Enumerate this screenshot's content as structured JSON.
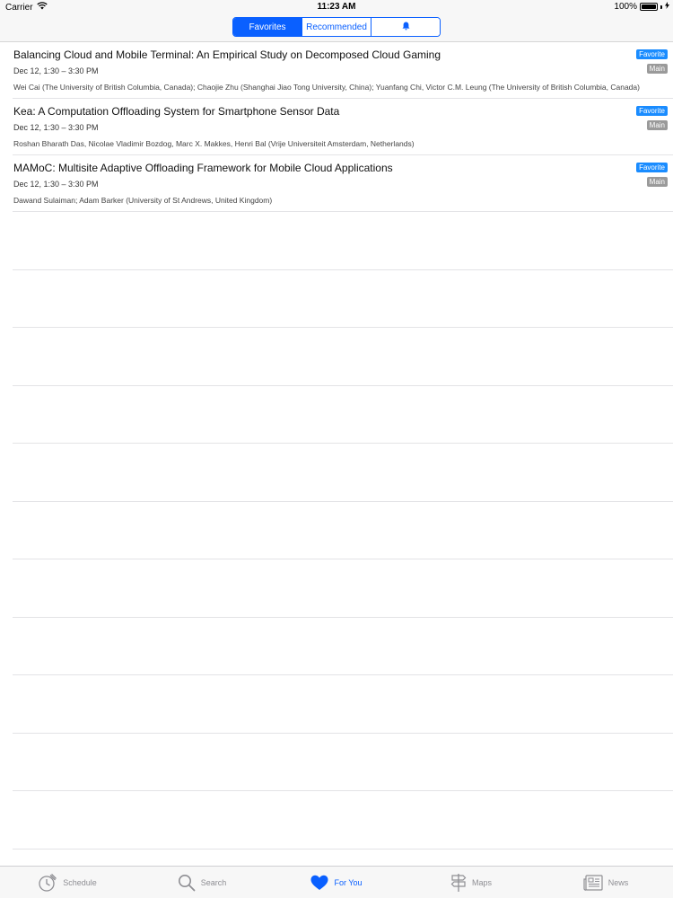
{
  "status_bar": {
    "carrier": "Carrier",
    "time": "11:23 AM",
    "battery": "100%",
    "battery_level": 1.0
  },
  "segments": [
    {
      "label": "Favorites",
      "active": true
    },
    {
      "label": "Recommended",
      "active": false
    },
    {
      "icon": "bell-icon",
      "active": false
    }
  ],
  "sessions": [
    {
      "title": "Balancing Cloud and Mobile Terminal: An Empirical Study on Decomposed Cloud Gaming",
      "time": "Dec 12, 1:30 – 3:30 PM",
      "authors": "Wei Cai (The University of British Columbia, Canada); Chaojie Zhu (Shanghai Jiao Tong University, China); Yuanfang Chi, Victor C.M. Leung (The University of British Columbia, Canada)",
      "badges": [
        "Favorite",
        "Main"
      ]
    },
    {
      "title": "Kea: A Computation Offloading System for Smartphone Sensor Data",
      "time": "Dec 12, 1:30 – 3:30 PM",
      "authors": "Roshan Bharath Das, Nicolae Vladimir Bozdog, Marc X. Makkes, Henri Bal (Vrije Universiteit Amsterdam, Netherlands)",
      "badges": [
        "Favorite",
        "Main"
      ]
    },
    {
      "title": "MAMoC: Multisite Adaptive Offloading Framework for Mobile Cloud Applications",
      "time": "Dec 12, 1:30 – 3:30 PM",
      "authors": "Dawand Sulaiman; Adam Barker (University of St Andrews, United Kingdom)",
      "badges": [
        "Favorite",
        "Main"
      ]
    }
  ],
  "tabs": [
    {
      "label": "Schedule",
      "icon": "clock-icon",
      "active": false
    },
    {
      "label": "Search",
      "icon": "search-icon",
      "active": false
    },
    {
      "label": "For You",
      "icon": "heart-icon",
      "active": true
    },
    {
      "label": "Maps",
      "icon": "signpost-icon",
      "active": false
    },
    {
      "label": "News",
      "icon": "newspaper-icon",
      "active": false
    }
  ],
  "colors": {
    "accent": "#0a60ff",
    "favorite_badge": "#1a8cff",
    "main_badge": "#9a9a9a"
  }
}
